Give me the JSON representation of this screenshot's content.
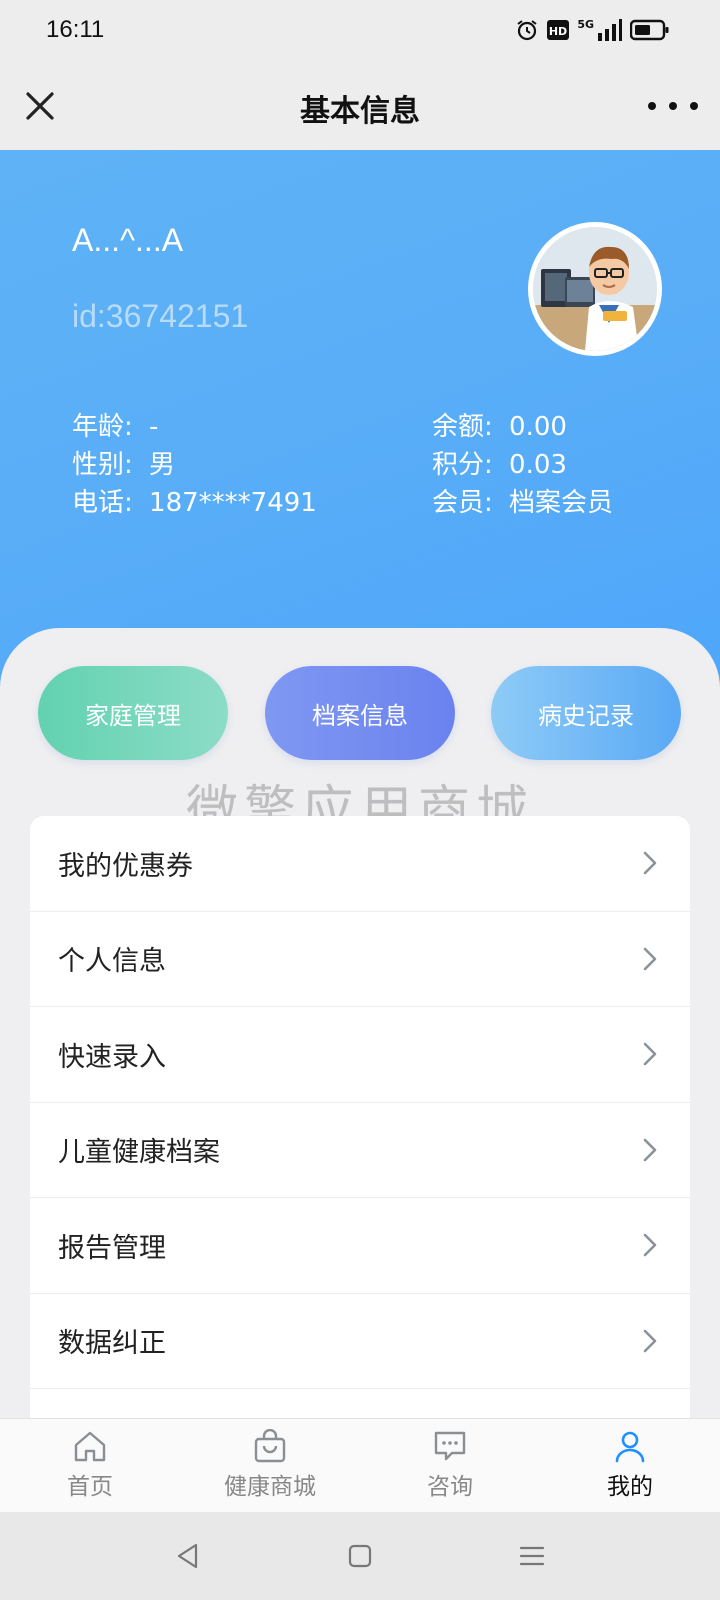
{
  "status_bar": {
    "time": "16:11",
    "network": "5G"
  },
  "nav": {
    "title": "基本信息"
  },
  "profile": {
    "name": "A...^...A",
    "id": "id:36742151",
    "age_label": "年龄:",
    "age_value": "-",
    "gender_label": "性别:",
    "gender_value": "男",
    "phone_label": "电话:",
    "phone_value": "187****7491",
    "balance_label": "余额:",
    "balance_value": "0.00",
    "points_label": "积分:",
    "points_value": "0.03",
    "member_label": "会员:",
    "member_value": "档案会员"
  },
  "quick_actions": [
    {
      "label": "家庭管理"
    },
    {
      "label": "档案信息"
    },
    {
      "label": "病史记录"
    }
  ],
  "watermark": "微擎应用商城",
  "menu": [
    {
      "label": "我的优惠券"
    },
    {
      "label": "个人信息"
    },
    {
      "label": "快速录入"
    },
    {
      "label": "儿童健康档案"
    },
    {
      "label": "报告管理"
    },
    {
      "label": "数据纠正"
    }
  ],
  "tabs": [
    {
      "label": "首页",
      "icon": "home-icon"
    },
    {
      "label": "健康商城",
      "icon": "shopping-bag-icon"
    },
    {
      "label": "咨询",
      "icon": "chat-icon"
    },
    {
      "label": "我的",
      "icon": "user-icon",
      "active": true
    }
  ],
  "colors": {
    "hero_blue": "#5aaef7",
    "family_green": "#62d2b0",
    "record_indigo": "#7f98f2",
    "history_blue": "#5aa9f5",
    "active_tab_icon": "#1e90ff"
  }
}
